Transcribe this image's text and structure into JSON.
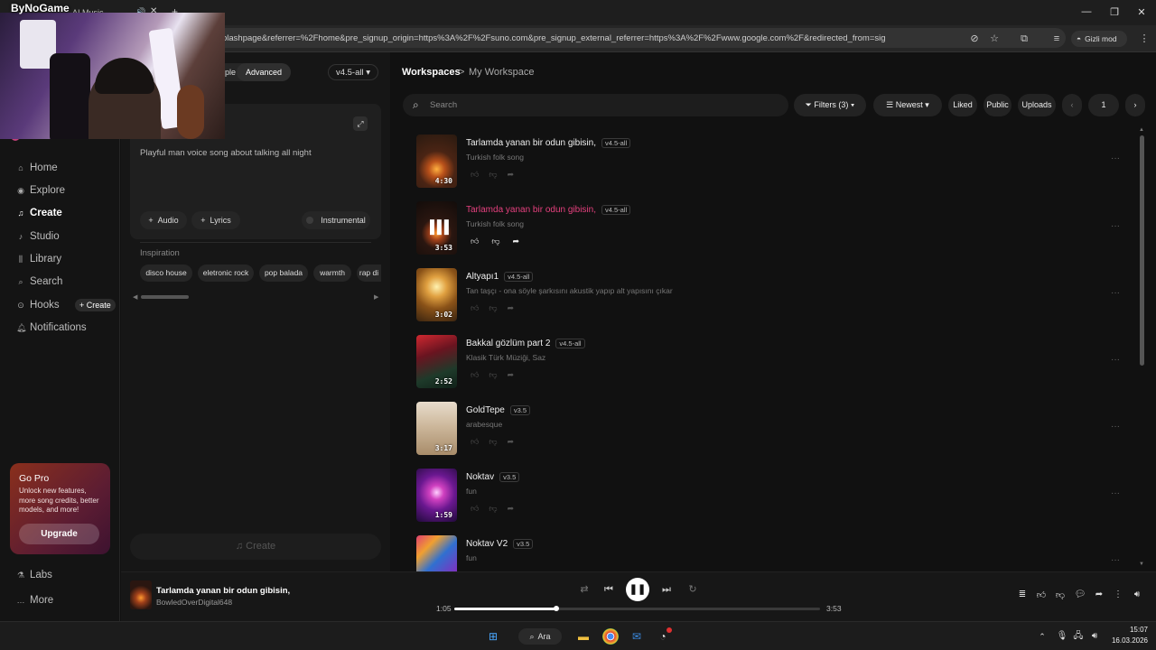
{
  "overlay": {
    "webcam_label": "ByNoGame"
  },
  "browser": {
    "tab_title": "AI Music",
    "url": "plashpage&referrer=%2Fhome&pre_signup_origin=https%3A%2F%2Fsuno.com&pre_signup_external_referrer=https%3A%2F%2Fwww.google.com%2F&redirected_from=signin",
    "profile_label": "Gizli mod"
  },
  "sidebar": {
    "items": [
      {
        "label": "Home",
        "icon": "home-icon"
      },
      {
        "label": "Explore",
        "icon": "compass-icon"
      },
      {
        "label": "Create",
        "icon": "music-note-icon"
      },
      {
        "label": "Studio",
        "icon": "studio-icon"
      },
      {
        "label": "Library",
        "icon": "library-icon"
      },
      {
        "label": "Search",
        "icon": "search-icon"
      },
      {
        "label": "Hooks",
        "icon": "hooks-icon"
      },
      {
        "label": "Notifications",
        "icon": "bell-icon"
      }
    ],
    "hooks_create": "+ Create",
    "promo": {
      "title": "Go Pro",
      "text": "Unlock new features, more song credits, better models, and more!",
      "button": "Upgrade"
    },
    "labs": "Labs",
    "more": "More"
  },
  "create": {
    "mode_simple": "ple",
    "mode_advanced": "Advanced",
    "version": "v4.5-all",
    "prompt": "Playful man voice song about talking all night",
    "audio_label": "Audio",
    "lyrics_label": "Lyrics",
    "instrumental_label": "Instrumental",
    "inspiration_label": "Inspiration",
    "inspiration_tags": [
      "disco house",
      "eletronic rock",
      "pop balada",
      "warmth",
      "rap di"
    ],
    "create_button": "Create"
  },
  "workspace": {
    "breadcrumb_root": "Workspaces",
    "breadcrumb_sep": ">",
    "breadcrumb_current": "My Workspace",
    "search_placeholder": "Search",
    "filters_label": "Filters (3)",
    "sort_label": "Newest",
    "liked_label": "Liked",
    "public_label": "Public",
    "uploads_label": "Uploads",
    "page": "1"
  },
  "songs": [
    {
      "title": "Tarlamda yanan bir odun gibisin,",
      "version": "v4.5-all",
      "subtitle": "Turkish folk song",
      "duration": "4:30",
      "playing": false
    },
    {
      "title": "Tarlamda yanan bir odun gibisin,",
      "version": "v4.5-all",
      "subtitle": "Turkish folk song",
      "duration": "3:53",
      "playing": true
    },
    {
      "title": "Altyapı1",
      "version": "v4.5-all",
      "subtitle": "Tan taşçı - ona söyle şarkısını akustik yapıp alt yapısını çıkar",
      "duration": "3:02",
      "playing": false
    },
    {
      "title": "Bakkal gözlüm part 2",
      "version": "v4.5-all",
      "subtitle": "Klasik Türk Müziği, Saz",
      "duration": "2:52",
      "playing": false
    },
    {
      "title": "GoldTepe",
      "version": "v3.5",
      "subtitle": "arabesque",
      "duration": "3:17",
      "playing": false
    },
    {
      "title": "Noktav",
      "version": "v3.5",
      "subtitle": "fun",
      "duration": "1:59",
      "playing": false
    },
    {
      "title": "Noktav V2",
      "version": "v3.5",
      "subtitle": "fun",
      "duration": "",
      "playing": false
    }
  ],
  "player": {
    "title": "Tarlamda yanan bir odun gibisin,",
    "artist": "BowledOverDigital648",
    "elapsed": "1:05",
    "total": "3:53",
    "progress": 0.28
  },
  "taskbar": {
    "search_label": "Ara",
    "time": "15:07",
    "date": "16.03.2026"
  },
  "colors": {
    "accent_playing": "#e5407e",
    "background": "#101010"
  }
}
